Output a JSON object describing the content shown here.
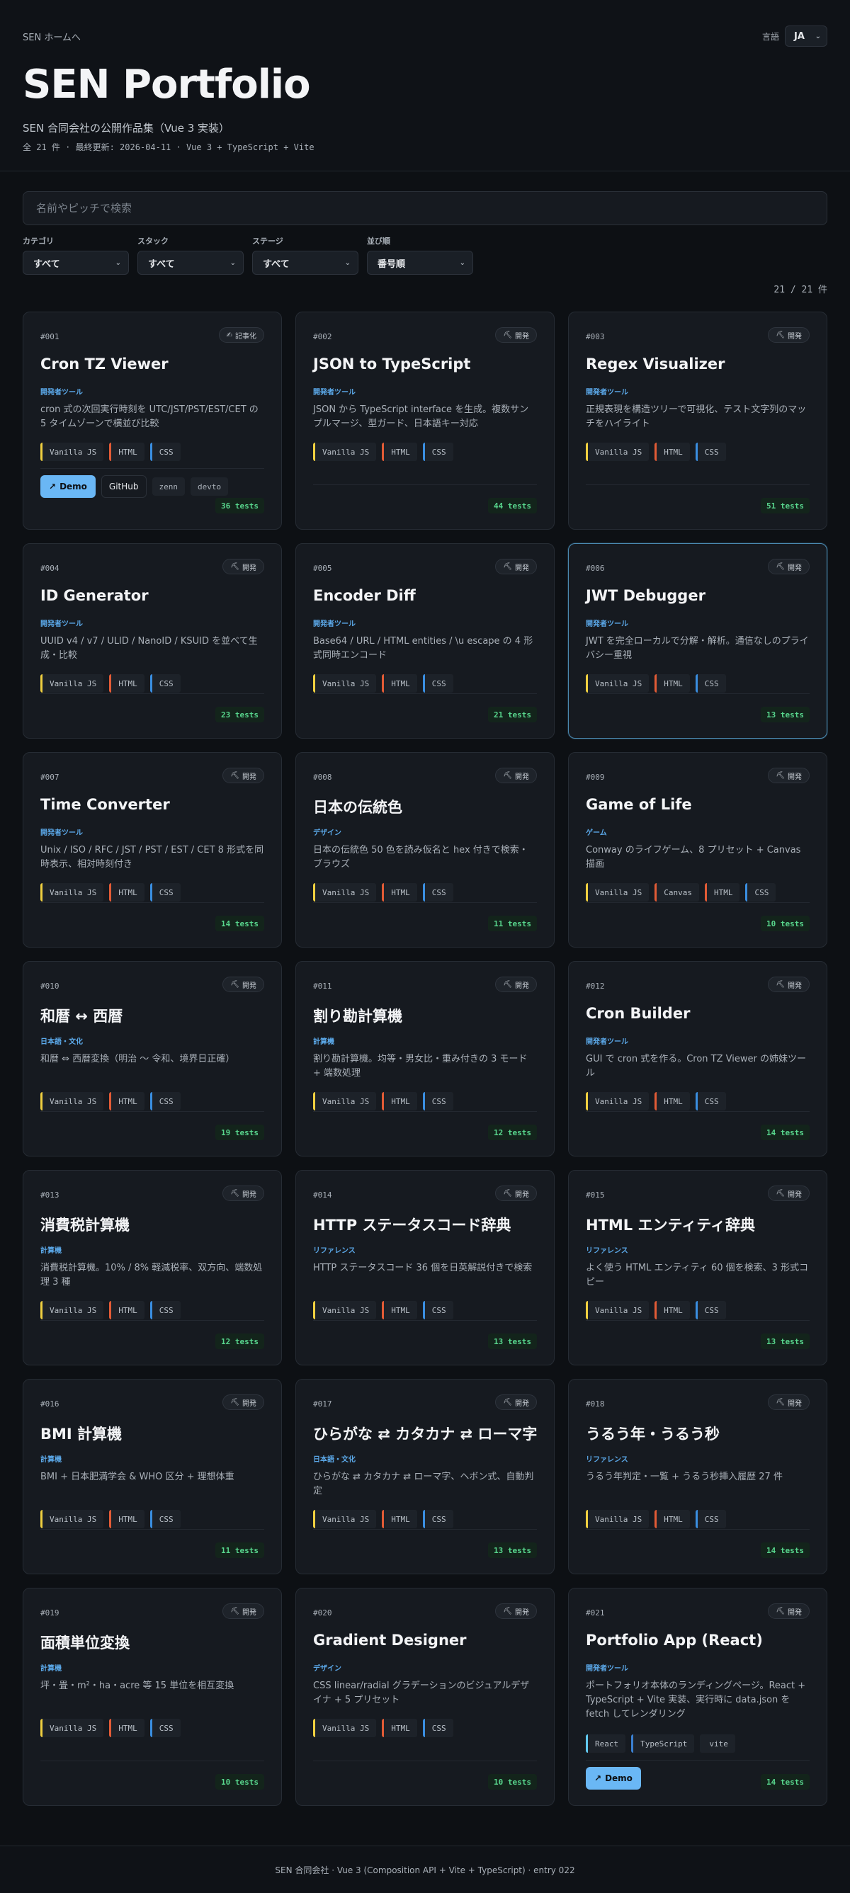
{
  "header": {
    "home_link": "SEN ホームへ",
    "lang_label": "言語",
    "lang_value": "JA",
    "title": "SEN Portfolio",
    "subtitle": "SEN 合同会社の公開作品集（Vue 3 実装）",
    "meta": "全 21 件 · 最終更新: 2026-04-11 · Vue 3 + TypeScript + Vite"
  },
  "search": {
    "placeholder": "名前やピッチで検索"
  },
  "filters": [
    {
      "label": "カテゴリ",
      "value": "すべて"
    },
    {
      "label": "スタック",
      "value": "すべて"
    },
    {
      "label": "ステージ",
      "value": "すべて"
    },
    {
      "label": "並び順",
      "value": "番号順"
    }
  ],
  "count": "21 / 21 件",
  "cards": [
    {
      "num": "#001",
      "stage": "記事化",
      "stage_icon": "✍",
      "title": "Cron TZ Viewer",
      "category": "開発者ツール",
      "desc": "cron 式の次回実行時刻を UTC/JST/PST/EST/CET の 5 タイムゾーンで横並び比較",
      "stack": [
        "Vanilla JS",
        "HTML",
        "CSS"
      ],
      "demo": "Demo",
      "github": "GitHub",
      "extra": [
        "zenn",
        "devto"
      ],
      "tests": "36 tests"
    },
    {
      "num": "#002",
      "stage": "開発",
      "stage_icon": "⛏",
      "title": "JSON to TypeScript",
      "category": "開発者ツール",
      "desc": "JSON から TypeScript interface を生成。複数サンプルマージ、型ガード、日本語キー対応",
      "stack": [
        "Vanilla JS",
        "HTML",
        "CSS"
      ],
      "tests": "44 tests"
    },
    {
      "num": "#003",
      "stage": "開発",
      "stage_icon": "⛏",
      "title": "Regex Visualizer",
      "category": "開発者ツール",
      "desc": "正規表現を構造ツリーで可視化、テスト文字列のマッチをハイライト",
      "stack": [
        "Vanilla JS",
        "HTML",
        "CSS"
      ],
      "tests": "51 tests"
    },
    {
      "num": "#004",
      "stage": "開発",
      "stage_icon": "⛏",
      "title": "ID Generator",
      "category": "開発者ツール",
      "desc": "UUID v4 / v7 / ULID / NanoID / KSUID を並べて生成・比較",
      "stack": [
        "Vanilla JS",
        "HTML",
        "CSS"
      ],
      "tests": "23 tests"
    },
    {
      "num": "#005",
      "stage": "開発",
      "stage_icon": "⛏",
      "title": "Encoder Diff",
      "category": "開発者ツール",
      "desc": "Base64 / URL / HTML entities / \\u escape の 4 形式同時エンコード",
      "stack": [
        "Vanilla JS",
        "HTML",
        "CSS"
      ],
      "tests": "21 tests"
    },
    {
      "num": "#006",
      "stage": "開発",
      "stage_icon": "⛏",
      "title": "JWT Debugger",
      "category": "開発者ツール",
      "desc": "JWT を完全ローカルで分解・解析。通信なしのプライバシー重視",
      "stack": [
        "Vanilla JS",
        "HTML",
        "CSS"
      ],
      "tests": "13 tests"
    },
    {
      "num": "#007",
      "stage": "開発",
      "stage_icon": "⛏",
      "title": "Time Converter",
      "category": "開発者ツール",
      "desc": "Unix / ISO / RFC / JST / PST / EST / CET 8 形式を同時表示、相対時刻付き",
      "stack": [
        "Vanilla JS",
        "HTML",
        "CSS"
      ],
      "tests": "14 tests"
    },
    {
      "num": "#008",
      "stage": "開発",
      "stage_icon": "⛏",
      "title": "日本の伝統色",
      "category": "デザイン",
      "desc": "日本の伝統色 50 色を読み仮名と hex 付きで検索・ブラウズ",
      "stack": [
        "Vanilla JS",
        "HTML",
        "CSS"
      ],
      "tests": "11 tests"
    },
    {
      "num": "#009",
      "stage": "開発",
      "stage_icon": "⛏",
      "title": "Game of Life",
      "category": "ゲーム",
      "desc": "Conway のライフゲーム、8 プリセット + Canvas 描画",
      "stack": [
        "Vanilla JS",
        "Canvas",
        "HTML",
        "CSS"
      ],
      "tests": "10 tests"
    },
    {
      "num": "#010",
      "stage": "開発",
      "stage_icon": "⛏",
      "title": "和暦 ↔ 西暦",
      "category": "日本語・文化",
      "desc": "和暦 ⇔ 西暦変換（明治 〜 令和、境界日正確）",
      "stack": [
        "Vanilla JS",
        "HTML",
        "CSS"
      ],
      "tests": "19 tests"
    },
    {
      "num": "#011",
      "stage": "開発",
      "stage_icon": "⛏",
      "title": "割り勘計算機",
      "category": "計算機",
      "desc": "割り勘計算機。均等・男女比・重み付きの 3 モード + 端数処理",
      "stack": [
        "Vanilla JS",
        "HTML",
        "CSS"
      ],
      "tests": "12 tests"
    },
    {
      "num": "#012",
      "stage": "開発",
      "stage_icon": "⛏",
      "title": "Cron Builder",
      "category": "開発者ツール",
      "desc": "GUI で cron 式を作る。Cron TZ Viewer の姉妹ツール",
      "stack": [
        "Vanilla JS",
        "HTML",
        "CSS"
      ],
      "tests": "14 tests"
    },
    {
      "num": "#013",
      "stage": "開発",
      "stage_icon": "⛏",
      "title": "消費税計算機",
      "category": "計算機",
      "desc": "消費税計算機。10% / 8% 軽減税率、双方向、端数処理 3 種",
      "stack": [
        "Vanilla JS",
        "HTML",
        "CSS"
      ],
      "tests": "12 tests"
    },
    {
      "num": "#014",
      "stage": "開発",
      "stage_icon": "⛏",
      "title": "HTTP ステータスコード辞典",
      "category": "リファレンス",
      "desc": "HTTP ステータスコード 36 個を日英解説付きで検索",
      "stack": [
        "Vanilla JS",
        "HTML",
        "CSS"
      ],
      "tests": "13 tests"
    },
    {
      "num": "#015",
      "stage": "開発",
      "stage_icon": "⛏",
      "title": "HTML エンティティ辞典",
      "category": "リファレンス",
      "desc": "よく使う HTML エンティティ 60 個を検索、3 形式コピー",
      "stack": [
        "Vanilla JS",
        "HTML",
        "CSS"
      ],
      "tests": "13 tests"
    },
    {
      "num": "#016",
      "stage": "開発",
      "stage_icon": "⛏",
      "title": "BMI 計算機",
      "category": "計算機",
      "desc": "BMI + 日本肥満学会 & WHO 区分 + 理想体重",
      "stack": [
        "Vanilla JS",
        "HTML",
        "CSS"
      ],
      "tests": "11 tests"
    },
    {
      "num": "#017",
      "stage": "開発",
      "stage_icon": "⛏",
      "title": "ひらがな ⇄ カタカナ ⇄ ローマ字",
      "category": "日本語・文化",
      "desc": "ひらがな ⇄ カタカナ ⇄ ローマ字、ヘボン式、自動判定",
      "stack": [
        "Vanilla JS",
        "HTML",
        "CSS"
      ],
      "tests": "13 tests"
    },
    {
      "num": "#018",
      "stage": "開発",
      "stage_icon": "⛏",
      "title": "うるう年・うるう秒",
      "category": "リファレンス",
      "desc": "うるう年判定・一覧 + うるう秒挿入履歴 27 件",
      "stack": [
        "Vanilla JS",
        "HTML",
        "CSS"
      ],
      "tests": "14 tests"
    },
    {
      "num": "#019",
      "stage": "開発",
      "stage_icon": "⛏",
      "title": "面積単位変換",
      "category": "計算機",
      "desc": "坪・畳・m²・ha・acre 等 15 単位を相互変換",
      "stack": [
        "Vanilla JS",
        "HTML",
        "CSS"
      ],
      "tests": "10 tests"
    },
    {
      "num": "#020",
      "stage": "開発",
      "stage_icon": "⛏",
      "title": "Gradient Designer",
      "category": "デザイン",
      "desc": "CSS linear/radial グラデーションのビジュアルデザイナ + 5 プリセット",
      "stack": [
        "Vanilla JS",
        "HTML",
        "CSS"
      ],
      "tests": "10 tests"
    },
    {
      "num": "#021",
      "stage": "開発",
      "stage_icon": "⛏",
      "title": "Portfolio App (React)",
      "category": "開発者ツール",
      "desc": "ポートフォリオ本体のランディングページ。React + TypeScript + Vite 実装、実行時に data.json を fetch してレンダリング",
      "stack": [
        "React",
        "TypeScript",
        "vite"
      ],
      "demo": "Demo",
      "tests": "14 tests"
    }
  ],
  "footer": "SEN 合同会社 · Vue 3 (Composition API + Vite + TypeScript) · entry 022",
  "colors": {
    "accent": "#6ab7f5",
    "category": "#5ba8e8",
    "tests": "#58d68d",
    "background": "#0d1014"
  }
}
